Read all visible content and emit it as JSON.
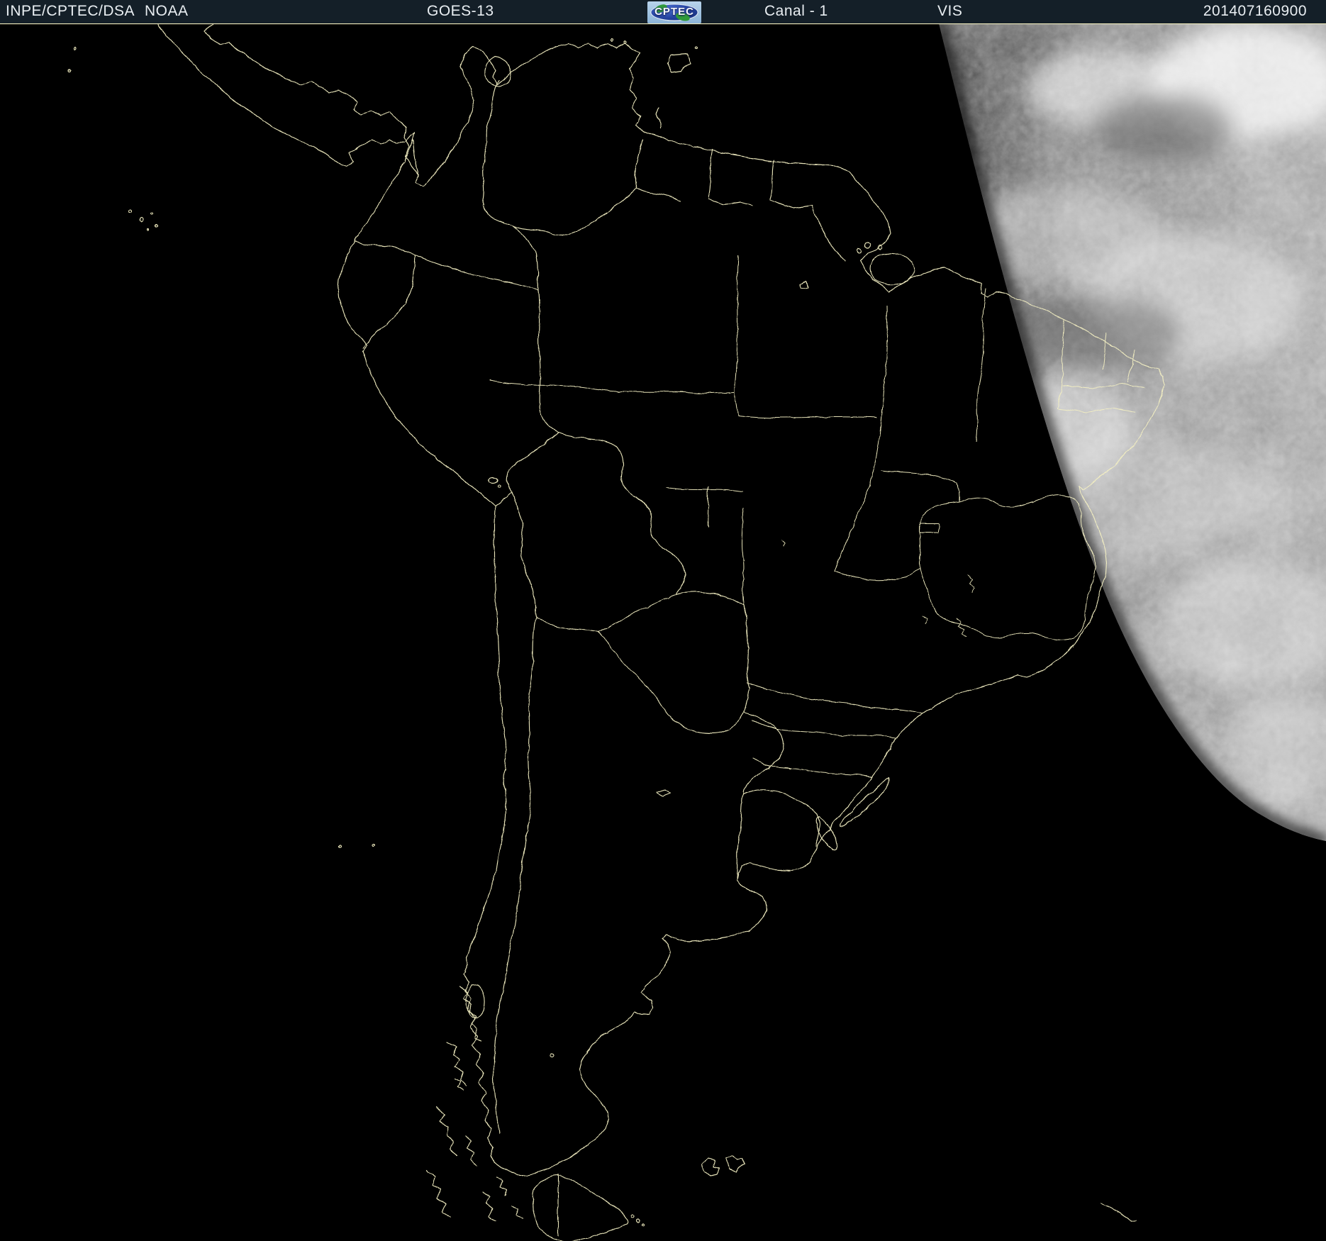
{
  "header": {
    "agency": "INPE/CPTEC/DSA",
    "noaa": "NOAA",
    "satellite": "GOES-13",
    "channel_label": "Canal - 1",
    "band": "VIS",
    "timestamp": "201407160900",
    "logo_text": "CPTEC",
    "colors": {
      "header_bg": "#141f28",
      "header_text": "#e9eef2",
      "logo_bg": "#9cc0e2",
      "logo_oval": "#23409c",
      "logo_land_green": "#2f9a3a"
    }
  },
  "map": {
    "colors": {
      "background": "#000000",
      "outline_yellow": "#f3efc2",
      "separator_line": "#eeeabc",
      "dayside_gray": "#8e8e8e"
    }
  }
}
